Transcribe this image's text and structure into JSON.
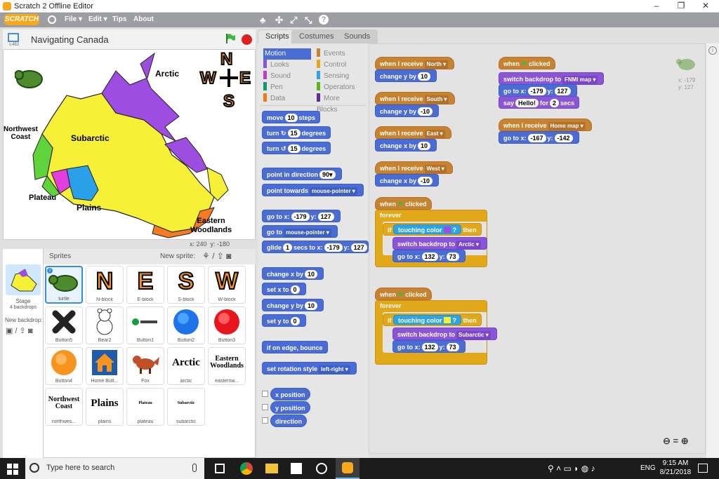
{
  "window": {
    "title": "Scratch 2 Offline Editor",
    "controls": [
      "–",
      "❐",
      "✕"
    ]
  },
  "menu": {
    "logo": "SCRATCH",
    "items": [
      "File ▾",
      "Edit ▾",
      "Tips",
      "About"
    ],
    "tools": [
      "♣",
      "✣",
      "⤢",
      "⤡",
      "?"
    ]
  },
  "stage": {
    "version": "v.462",
    "title": "Navigating Canada",
    "coords_x": "x: 240",
    "coords_y": "y: -180",
    "labels": {
      "arctic": "Arctic",
      "subarctic": "Subarctic",
      "nw": "Northwest\nCoast",
      "plateau": "Plateau",
      "plains": "Plains",
      "eastern": "Eastern\nWoodlands"
    },
    "compass": {
      "n": "N",
      "w": "W",
      "e": "E",
      "s": "S"
    }
  },
  "sprites": {
    "header": "Sprites",
    "new_sprite": "New sprite:",
    "stage_label": "Stage",
    "stage_sub": "4 backdrops",
    "new_backdrop": "New backdrop:",
    "tiles": [
      {
        "name": "turtle",
        "kind": "turtle"
      },
      {
        "name": "N-block",
        "kind": "letter",
        "text": "N"
      },
      {
        "name": "E-block",
        "kind": "letter",
        "text": "E"
      },
      {
        "name": "S-block",
        "kind": "letter",
        "text": "S"
      },
      {
        "name": "W-block",
        "kind": "letter",
        "text": "W"
      },
      {
        "name": "Button5",
        "kind": "x"
      },
      {
        "name": "Bear2",
        "kind": "bear"
      },
      {
        "name": "Button1",
        "kind": "btn1"
      },
      {
        "name": "Button2",
        "kind": "blue"
      },
      {
        "name": "Button3",
        "kind": "red"
      },
      {
        "name": "Button4",
        "kind": "orange"
      },
      {
        "name": "Home Butt...",
        "kind": "home"
      },
      {
        "name": "Fox",
        "kind": "fox"
      },
      {
        "name": "arctic",
        "kind": "word",
        "text": "Arctic"
      },
      {
        "name": "easternw...",
        "kind": "word",
        "text": "Eastern Woodlands"
      },
      {
        "name": "northwes...",
        "kind": "word",
        "text": "Northwest Coast"
      },
      {
        "name": "plains",
        "kind": "word",
        "text": "Plains"
      },
      {
        "name": "plateau",
        "kind": "tiny",
        "text": "Plateau"
      },
      {
        "name": "subarctic",
        "kind": "tiny",
        "text": "Subarctic"
      }
    ]
  },
  "tabs": [
    "Scripts",
    "Costumes",
    "Sounds"
  ],
  "categories": [
    {
      "label": "Motion",
      "color": "#4a6cd4"
    },
    {
      "label": "Events",
      "color": "#c88330"
    },
    {
      "label": "Looks",
      "color": "#8a55d7"
    },
    {
      "label": "Control",
      "color": "#e1a91a"
    },
    {
      "label": "Sound",
      "color": "#bb42c3"
    },
    {
      "label": "Sensing",
      "color": "#2ca5e2"
    },
    {
      "label": "Pen",
      "color": "#0e9a6c"
    },
    {
      "label": "Operators",
      "color": "#5cb712"
    },
    {
      "label": "Data",
      "color": "#ee7d16"
    },
    {
      "label": "More Blocks",
      "color": "#632d99"
    }
  ],
  "palette": {
    "move": "move",
    "move_v": "10",
    "steps": "steps",
    "turn_r": "turn ↻",
    "turn_r_v": "15",
    "degrees": "degrees",
    "turn_l": "turn ↺",
    "turn_l_v": "15",
    "point_dir": "point in direction",
    "point_dir_v": "90▾",
    "point_towards": "point towards",
    "point_towards_v": "mouse-pointer ▾",
    "goto": "go to x:",
    "goto_x": "-179",
    "goto_y_l": "y:",
    "goto_y": "127",
    "goto_m": "go to",
    "goto_m_v": "mouse-pointer ▾",
    "glide": "glide",
    "glide_v": "1",
    "glide_m": "secs to x:",
    "glide_x": "-179",
    "glide_y": "127",
    "chx": "change x by",
    "chx_v": "10",
    "setx": "set x to",
    "setx_v": "0",
    "chy": "change y by",
    "chy_v": "10",
    "sety": "set y to",
    "sety_v": "0",
    "bounce": "if on edge, bounce",
    "rot": "set rotation style",
    "rot_v": "left-right ▾",
    "xpos": "x position",
    "ypos": "y position",
    "dir": "direction"
  },
  "scripts": {
    "when_receive": "when I receive",
    "change_y": "change y by",
    "change_x": "change x by",
    "north": "North ▾",
    "south": "South ▾",
    "east": "East ▾",
    "west": "West ▾",
    "v10": "10",
    "vm10": "-10",
    "when": "when",
    "clicked": "clicked",
    "forever": "forever",
    "if": "if",
    "then": "then",
    "touching": "touching color",
    "q": "?",
    "switch": "switch backdrop to",
    "arctic": "Arctic ▾",
    "subarctic": "Subarctic ▾",
    "goto": "go to x:",
    "y": "y:",
    "x132": "132",
    "y73": "73",
    "fnmi": "FNMI map ▾",
    "x179": "-179",
    "y127": "127",
    "say": "say",
    "hello": "Hello!",
    "for": "for",
    "two": "2",
    "secs": "secs",
    "homemap": "Home map ▾",
    "x167": "-167",
    "y142": "-142",
    "sx": "x: -179",
    "sy": "y: 127",
    "zoom": "⊖ = ⊕"
  },
  "taskbar": {
    "search": "Type here to search",
    "time": "9:15 AM",
    "date": "8/21/2018",
    "lang": "ENG"
  }
}
